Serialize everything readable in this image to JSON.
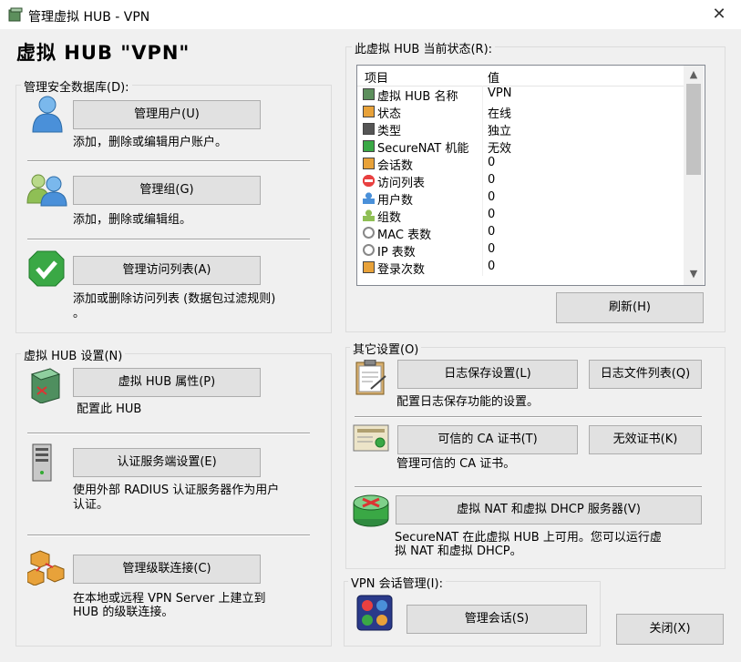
{
  "window": {
    "title": "管理虚拟 HUB - VPN",
    "close_glyph": "✕"
  },
  "header": {
    "title": "虚拟 HUB \"VPN\""
  },
  "security_db": {
    "label": "管理安全数据库(D):",
    "users_button": "管理用户(U)",
    "users_desc": "添加，删除或编辑用户账户。",
    "groups_button": "管理组(G)",
    "groups_desc": "添加，删除或编辑组。",
    "acl_button": "管理访问列表(A)",
    "acl_desc_line1": "添加或删除访问列表 (数据包过滤规则)",
    "acl_desc_line2": "。"
  },
  "hub_settings": {
    "label": "虚拟 HUB 设置(N)",
    "props_button": "虚拟 HUB 属性(P)",
    "props_desc": "配置此 HUB",
    "auth_button": "认证服务端设置(E)",
    "auth_desc_line1": "使用外部 RADIUS 认证服务器作为用户",
    "auth_desc_line2": "认证。",
    "cascade_button": "管理级联连接(C)",
    "cascade_desc_line1": "在本地或远程 VPN Server 上建立到",
    "cascade_desc_line2": "HUB 的级联连接。"
  },
  "status": {
    "label": "此虚拟 HUB 当前状态(R):",
    "col_item": "项目",
    "col_value": "值",
    "rows": [
      {
        "icon": "hub-icon",
        "item": "虚拟 HUB 名称",
        "value": "VPN"
      },
      {
        "icon": "status-icon",
        "item": "状态",
        "value": "在线"
      },
      {
        "icon": "type-icon",
        "item": "类型",
        "value": "独立"
      },
      {
        "icon": "securenat-icon",
        "item": "SecureNAT 机能",
        "value": "无效"
      },
      {
        "icon": "session-icon",
        "item": "会话数",
        "value": "0"
      },
      {
        "icon": "access-list-icon",
        "item": "访问列表",
        "value": "0"
      },
      {
        "icon": "user-icon",
        "item": "用户数",
        "value": "0"
      },
      {
        "icon": "group-icon",
        "item": "组数",
        "value": "0"
      },
      {
        "icon": "mac-table-icon",
        "item": "MAC 表数",
        "value": "0"
      },
      {
        "icon": "ip-table-icon",
        "item": "IP 表数",
        "value": "0"
      },
      {
        "icon": "login-icon",
        "item": "登录次数",
        "value": "0"
      }
    ],
    "refresh_button": "刷新(H)"
  },
  "other": {
    "label": "其它设置(O)",
    "log_button": "日志保存设置(L)",
    "logfiles_button": "日志文件列表(Q)",
    "log_desc": "配置日志保存功能的设置。",
    "ca_button": "可信的 CA 证书(T)",
    "crl_button": "无效证书(K)",
    "ca_desc": "管理可信的 CA 证书。",
    "nat_button": "虚拟 NAT 和虚拟 DHCP 服务器(V)",
    "nat_desc_line1": "SecureNAT 在此虚拟 HUB 上可用。您可以运行虚",
    "nat_desc_line2": "拟 NAT 和虚拟 DHCP。"
  },
  "sessions": {
    "label": "VPN 会话管理(I):",
    "button": "管理会话(S)"
  },
  "footer": {
    "close_button": "关闭(X)"
  },
  "colors": {
    "accent_green": "#3aa845",
    "user_blue": "#4a90d9",
    "bg": "#f0f0f0"
  }
}
